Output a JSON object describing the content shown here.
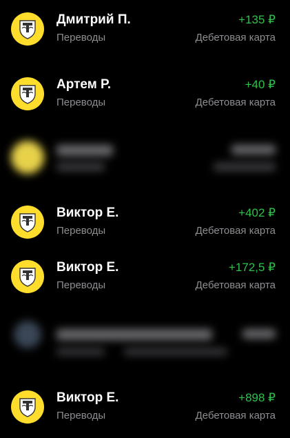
{
  "transactions": [
    {
      "name": "Дмитрий П.",
      "category": "Переводы",
      "amount": "+135 ₽",
      "account": "Дебетовая карта",
      "icon": "tinkoff-logo-icon"
    },
    {
      "name": "Артем Р.",
      "category": "Переводы",
      "amount": "+40 ₽",
      "account": "Дебетовая карта",
      "icon": "tinkoff-logo-icon"
    },
    {
      "name": "Виктор Е.",
      "category": "Переводы",
      "amount": "+402 ₽",
      "account": "Дебетовая карта",
      "icon": "tinkoff-logo-icon"
    },
    {
      "name": "Виктор Е.",
      "category": "Переводы",
      "amount": "+172,5 ₽",
      "account": "Дебетовая карта",
      "icon": "tinkoff-logo-icon"
    },
    {
      "name": "Виктор Е.",
      "category": "Переводы",
      "amount": "+898 ₽",
      "account": "Дебетовая карта",
      "icon": "tinkoff-logo-icon"
    }
  ],
  "colors": {
    "background": "#000000",
    "income": "#2EC34A",
    "secondary_text": "#8E8E93",
    "brand_yellow": "#FFDD2D"
  }
}
